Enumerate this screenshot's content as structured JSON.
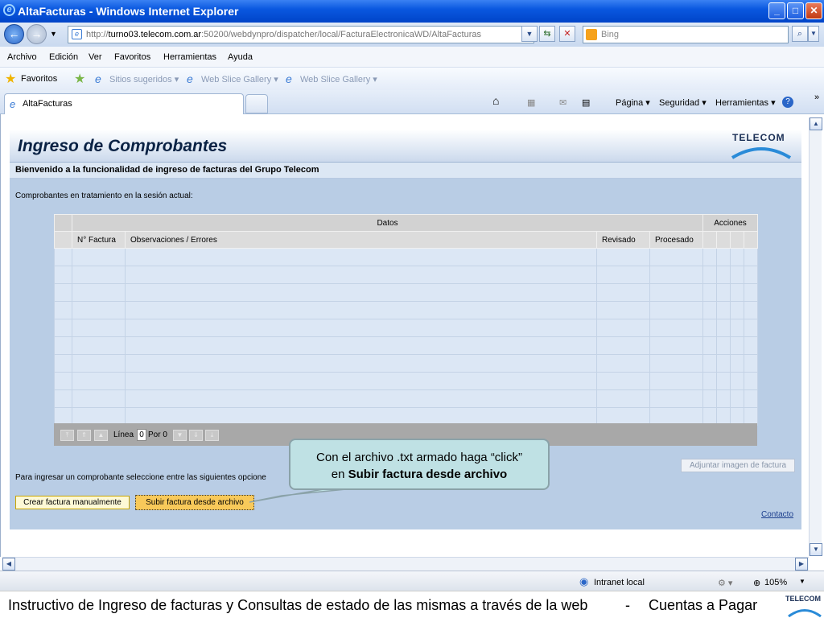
{
  "window": {
    "title": "AltaFacturas - Windows Internet Explorer",
    "minimize": "_",
    "maximize": "□",
    "close": "✕"
  },
  "address": {
    "url_prefix": "http://",
    "url_host": "turno03.telecom.com.ar",
    "url_rest": ":50200/webdynpro/dispatcher/local/FacturaElectronicaWD/AltaFacturas",
    "search_placeholder": "Bing"
  },
  "menu": [
    "Archivo",
    "Edición",
    "Ver",
    "Favoritos",
    "Herramientas",
    "Ayuda"
  ],
  "favbar": {
    "favorites": "Favoritos",
    "items": [
      "Sitios sugeridos ▾",
      "Web Slice Gallery ▾",
      "Web Slice Gallery ▾"
    ]
  },
  "tabs": {
    "active": "AltaFacturas",
    "commands": [
      "Página ▾",
      "Seguridad ▾",
      "Herramientas ▾"
    ]
  },
  "page": {
    "title": "Ingreso de Comprobantes",
    "logo": "TELECOM",
    "welcome": "Bienvenido a la funcionalidad de ingreso de facturas del Grupo Telecom",
    "session_label": "Comprobantes en tratamiento en la sesión actual:",
    "table": {
      "group_datos": "Datos",
      "group_acciones": "Acciones",
      "col_factura": "N° Factura",
      "col_obs": "Observaciones / Errores",
      "col_revisado": "Revisado",
      "col_procesado": "Procesado",
      "row_count": 10,
      "linea_label": "Línea",
      "linea_value": "0",
      "por_label": "Por 0"
    },
    "adjuntar": "Adjuntar imagen de factura",
    "ingresar_text": "Para ingresar un comprobante seleccione entre las siguientes opcione",
    "btn_crear": "Crear factura manualmente",
    "btn_subir": "Subir factura desde archivo",
    "contacto": "Contacto"
  },
  "callout": {
    "line1": "Con el archivo .txt armado  haga “click”",
    "line2_prefix": "en ",
    "line2_bold": "Subir factura desde archivo"
  },
  "status": {
    "zone": "Intranet local",
    "zoom": "105%"
  },
  "footer": {
    "text": "Instructivo de Ingreso de facturas y Consultas de estado de las mismas a través de la web",
    "separator": "-",
    "right": "Cuentas a Pagar",
    "logo": "TELECOM"
  }
}
